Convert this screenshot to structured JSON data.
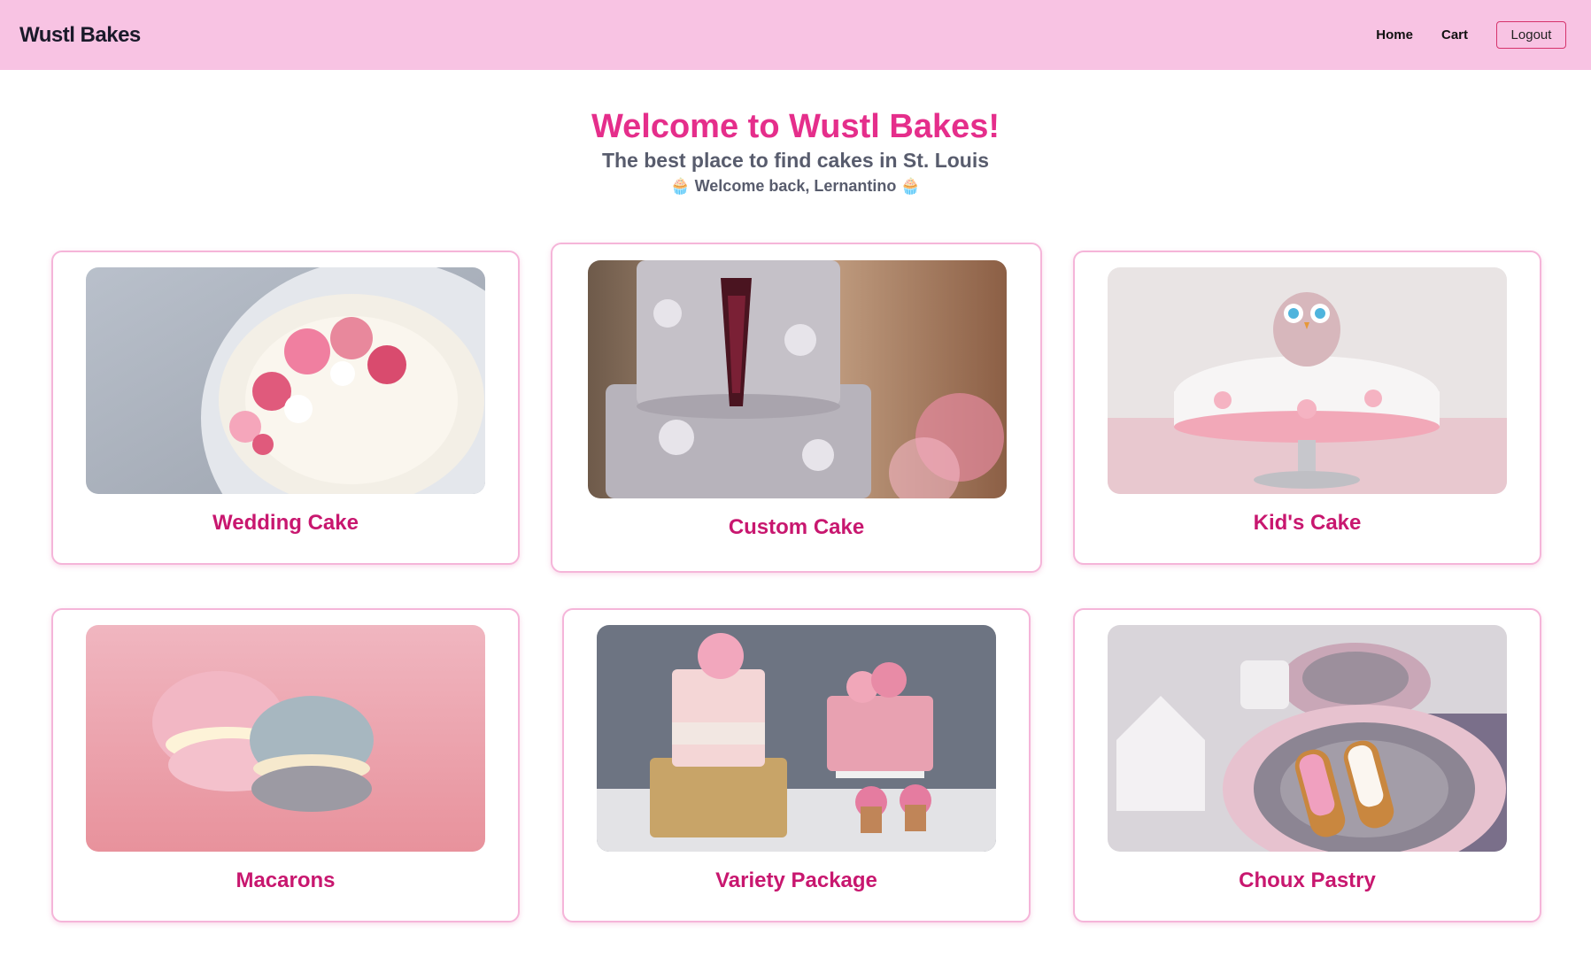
{
  "nav": {
    "brand": "Wustl Bakes",
    "links": [
      {
        "label": "Home"
      },
      {
        "label": "Cart"
      }
    ],
    "logout_label": "Logout"
  },
  "hero": {
    "title": "Welcome to Wustl Bakes!",
    "subtitle": "The best place to find cakes in St. Louis",
    "welcome": "🧁 Welcome back, Lernantino 🧁"
  },
  "products": [
    {
      "name": "Wedding Cake",
      "image": "wedding-cake-photo"
    },
    {
      "name": "Custom Cake",
      "image": "custom-cake-photo"
    },
    {
      "name": "Kid's Cake",
      "image": "kids-cake-photo"
    },
    {
      "name": "Macarons",
      "image": "macarons-photo"
    },
    {
      "name": "Variety Package",
      "image": "variety-package-photo"
    },
    {
      "name": "Choux Pastry",
      "image": "choux-pastry-photo"
    }
  ],
  "colors": {
    "nav_bg": "#f8c3e3",
    "accent": "#e52e8b",
    "card_title": "#c8176f",
    "card_border": "#f5b5d9"
  }
}
